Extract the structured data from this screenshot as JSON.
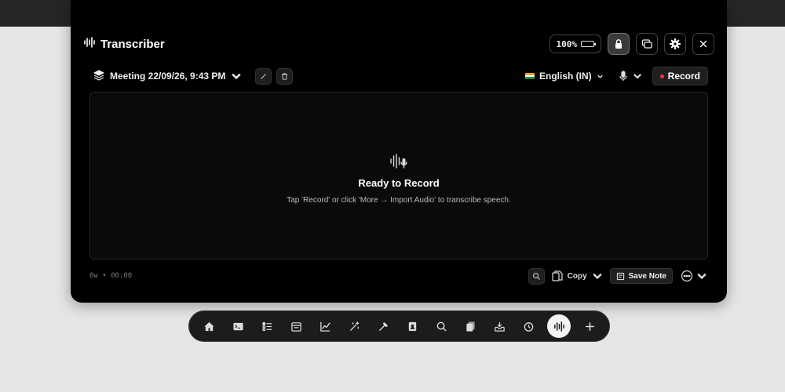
{
  "app": {
    "title": "Transcriber"
  },
  "header": {
    "battery_label": "100%"
  },
  "toolbar": {
    "meeting_title": "Meeting 22/09/26, 9:43 PM",
    "language": "English (IN)",
    "record_label": "Record"
  },
  "empty_state": {
    "title": "Ready to Record",
    "hint": "Tap 'Record' or click 'More → Import Audio' to transcribe speech."
  },
  "footer": {
    "status": "0w • 00:00",
    "copy_label": "Copy",
    "save_label": "Save Note"
  },
  "dock": {
    "items": [
      "home-icon",
      "terminal-icon",
      "checklist-icon",
      "calendar-icon",
      "chart-icon",
      "magic-wand-icon",
      "eyedropper-icon",
      "contacts-icon",
      "search-icon",
      "documents-icon",
      "inbox-icon",
      "timer-icon",
      "transcriber-icon",
      "plus-icon"
    ],
    "active": "transcriber-icon"
  },
  "colors": {
    "record_dot": "#e33333",
    "background": "#e6e6e6",
    "window": "#000000"
  }
}
